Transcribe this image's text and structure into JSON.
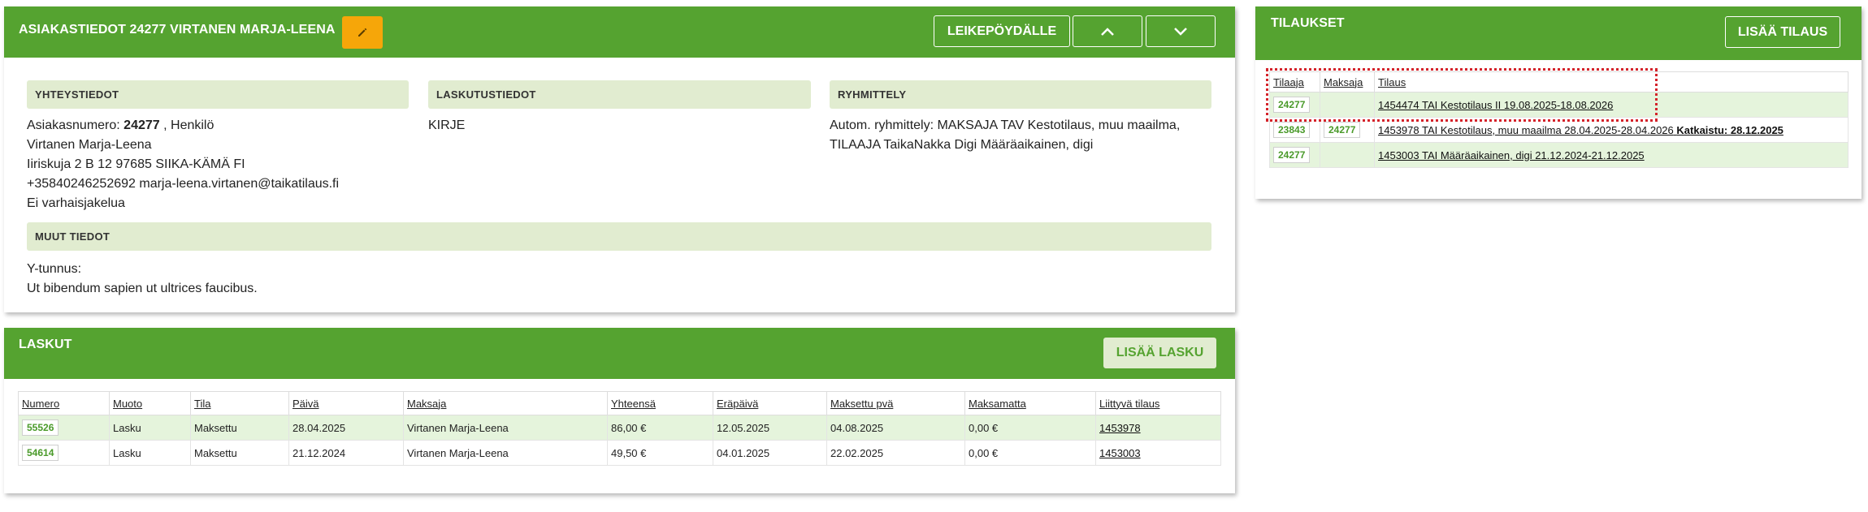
{
  "customer": {
    "title": "ASIAKASTIEDOT 24277 VIRTANEN MARJA-LEENA",
    "clipboard_label": "LEIKEPÖYDÄLLE",
    "sections": {
      "contact": "YHTEYSTIEDOT",
      "billing": "LASKUTUSTIEDOT",
      "grouping": "RYHMITTELY",
      "other": "MUUT TIEDOT"
    },
    "contact": {
      "number_label": "Asiakasnumero:",
      "number": "24277",
      "type": ", Henkilö",
      "name": "Virtanen Marja-Leena",
      "address": "Iiriskuja 2 B 12 97685 SIIKA-KÄMÄ FI",
      "phone_email": "+35840246252692 marja-leena.virtanen@taikatilaus.fi",
      "delivery": "Ei varhaisjakelua"
    },
    "billing": {
      "method": "KIRJE"
    },
    "grouping": {
      "line1": "Autom. ryhmittely: MAKSAJA TAV Kestotilaus, muu maailma,",
      "line2": "TILAAJA TaikaNakka Digi Määräaikainen, digi"
    },
    "other": {
      "ytunnus": "Y-tunnus:",
      "note": "Ut bibendum sapien ut ultrices faucibus."
    }
  },
  "invoices": {
    "title": "LASKUT",
    "add_label": "LISÄÄ LASKU",
    "columns": [
      "Numero",
      "Muoto",
      "Tila",
      "Päivä",
      "Maksaja",
      "Yhteensä",
      "Eräpäivä",
      "Maksettu pvä",
      "Maksamatta",
      "Liittyvä tilaus"
    ],
    "rows": [
      {
        "numero": "55526",
        "muoto": "Lasku",
        "tila": "Maksettu",
        "paiva": "28.04.2025",
        "maksaja": "Virtanen Marja-Leena",
        "yhteensa": "86,00 €",
        "erapaiva": "12.05.2025",
        "maksettu": "04.08.2025",
        "maksamatta": "0,00 €",
        "tilaus": "1453978"
      },
      {
        "numero": "54614",
        "muoto": "Lasku",
        "tila": "Maksettu",
        "paiva": "21.12.2024",
        "maksaja": "Virtanen Marja-Leena",
        "yhteensa": "49,50 €",
        "erapaiva": "04.01.2025",
        "maksettu": "22.02.2025",
        "maksamatta": "0,00 €",
        "tilaus": "1453003"
      }
    ]
  },
  "orders": {
    "title": "TILAUKSET",
    "add_label": "LISÄÄ TILAUS",
    "columns": [
      "Tilaaja",
      "Maksaja",
      "Tilaus"
    ],
    "rows": [
      {
        "tilaaja": "24277",
        "maksaja": "",
        "tilaus": "1454474 TAI Kestotilaus II 19.08.2025-18.08.2026",
        "note_bold": ""
      },
      {
        "tilaaja": "23843",
        "maksaja": "24277",
        "tilaus": "1453978 TAI Kestotilaus, muu maailma 28.04.2025-28.04.2026",
        "note_bold": "Katkaistu: 28.12.2025"
      },
      {
        "tilaaja": "24277",
        "maksaja": "",
        "tilaus": "1453003 TAI Määräaikainen, digi 21.12.2024-21.12.2025",
        "note_bold": ""
      }
    ]
  },
  "icons": {
    "edit": "pencil-icon",
    "up": "chevron-up-icon",
    "down": "chevron-down-icon"
  },
  "colors": {
    "header": "#55a330",
    "edit": "#f6a609",
    "section": "#e1ecd0",
    "row_alt": "#e5f4dc",
    "selection": "#d4232a"
  }
}
